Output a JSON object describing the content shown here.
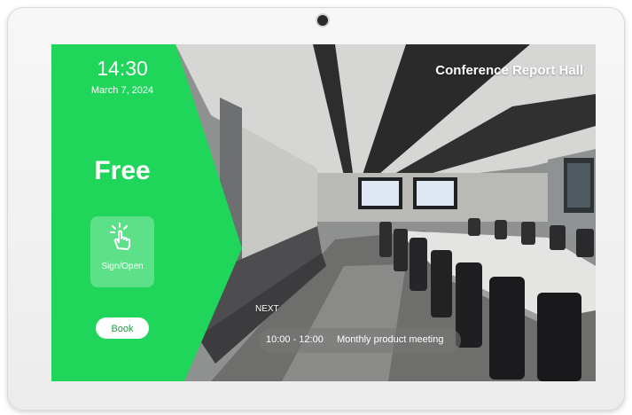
{
  "status_panel": {
    "time": "14:30",
    "date": "March 7, 2024",
    "status": "Free",
    "sign_open_label": "Sign/Open",
    "book_label": "Book",
    "accent_color": "#1fd65a"
  },
  "room": {
    "name": "Conference Report Hall"
  },
  "next_meeting": {
    "label": "NEXT",
    "time_range": "10:00 - 12:00",
    "title": "Monthly product meeting"
  },
  "icons": {
    "sign_open": "tap-finger-icon",
    "camera": "camera-icon"
  }
}
